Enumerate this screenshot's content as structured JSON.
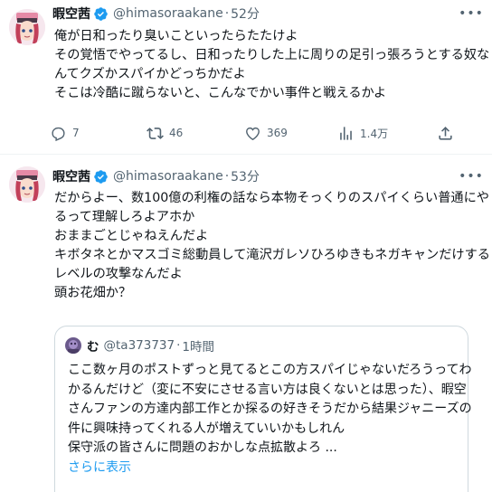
{
  "tweet1": {
    "name": "暇空茜",
    "handle": "@himasoraakane",
    "time": "52分",
    "lines": [
      "俺が日和ったり臭いこといったらたたけよ",
      "その覚悟でやってるし、日和ったりした上に周りの足引っ張ろうとする奴な",
      "んてクズかスパイかどっちかだよ",
      "そこは冷酷に蹴らないと、こんなでかい事件と戦えるかよ"
    ],
    "actions": {
      "reply": "7",
      "retweet": "46",
      "like": "369",
      "views": "1.4万"
    }
  },
  "tweet2": {
    "name": "暇空茜",
    "handle": "@himasoraakane",
    "time": "53分",
    "lines": [
      "だからよー、数100億の利権の話なら本物そっくりのスパイくらい普通にや",
      "るって理解しろよアホか",
      "おままごとじゃねえんだよ",
      "キボタネとかマスゴミ総動員して滝沢ガレソひろゆきもネガキャンだけする",
      "レベルの攻撃なんだよ",
      "頭お花畑か？"
    ],
    "quote": {
      "name": "む",
      "handle": "@ta373737",
      "time": "1時間",
      "lines": [
        "ここ数ヶ月のポストずっと見てるとこの方スパイじゃないだろうってわ",
        "かるんだけど（変に不安にさせる言い方は良くないとは思った）、暇空",
        "さんファンの方達内部工作とか探るの好きそうだから結果ジャニーズの",
        "件に興味持ってくれる人が増えていいかもしれん",
        "保守派の皆さんに問題のおかしな点拡散よろ ..."
      ],
      "more_label": "さらに表示"
    }
  },
  "colors": {
    "verified": "#1d9bf0",
    "secondary_text": "#536471",
    "link": "#1d9bf0"
  }
}
